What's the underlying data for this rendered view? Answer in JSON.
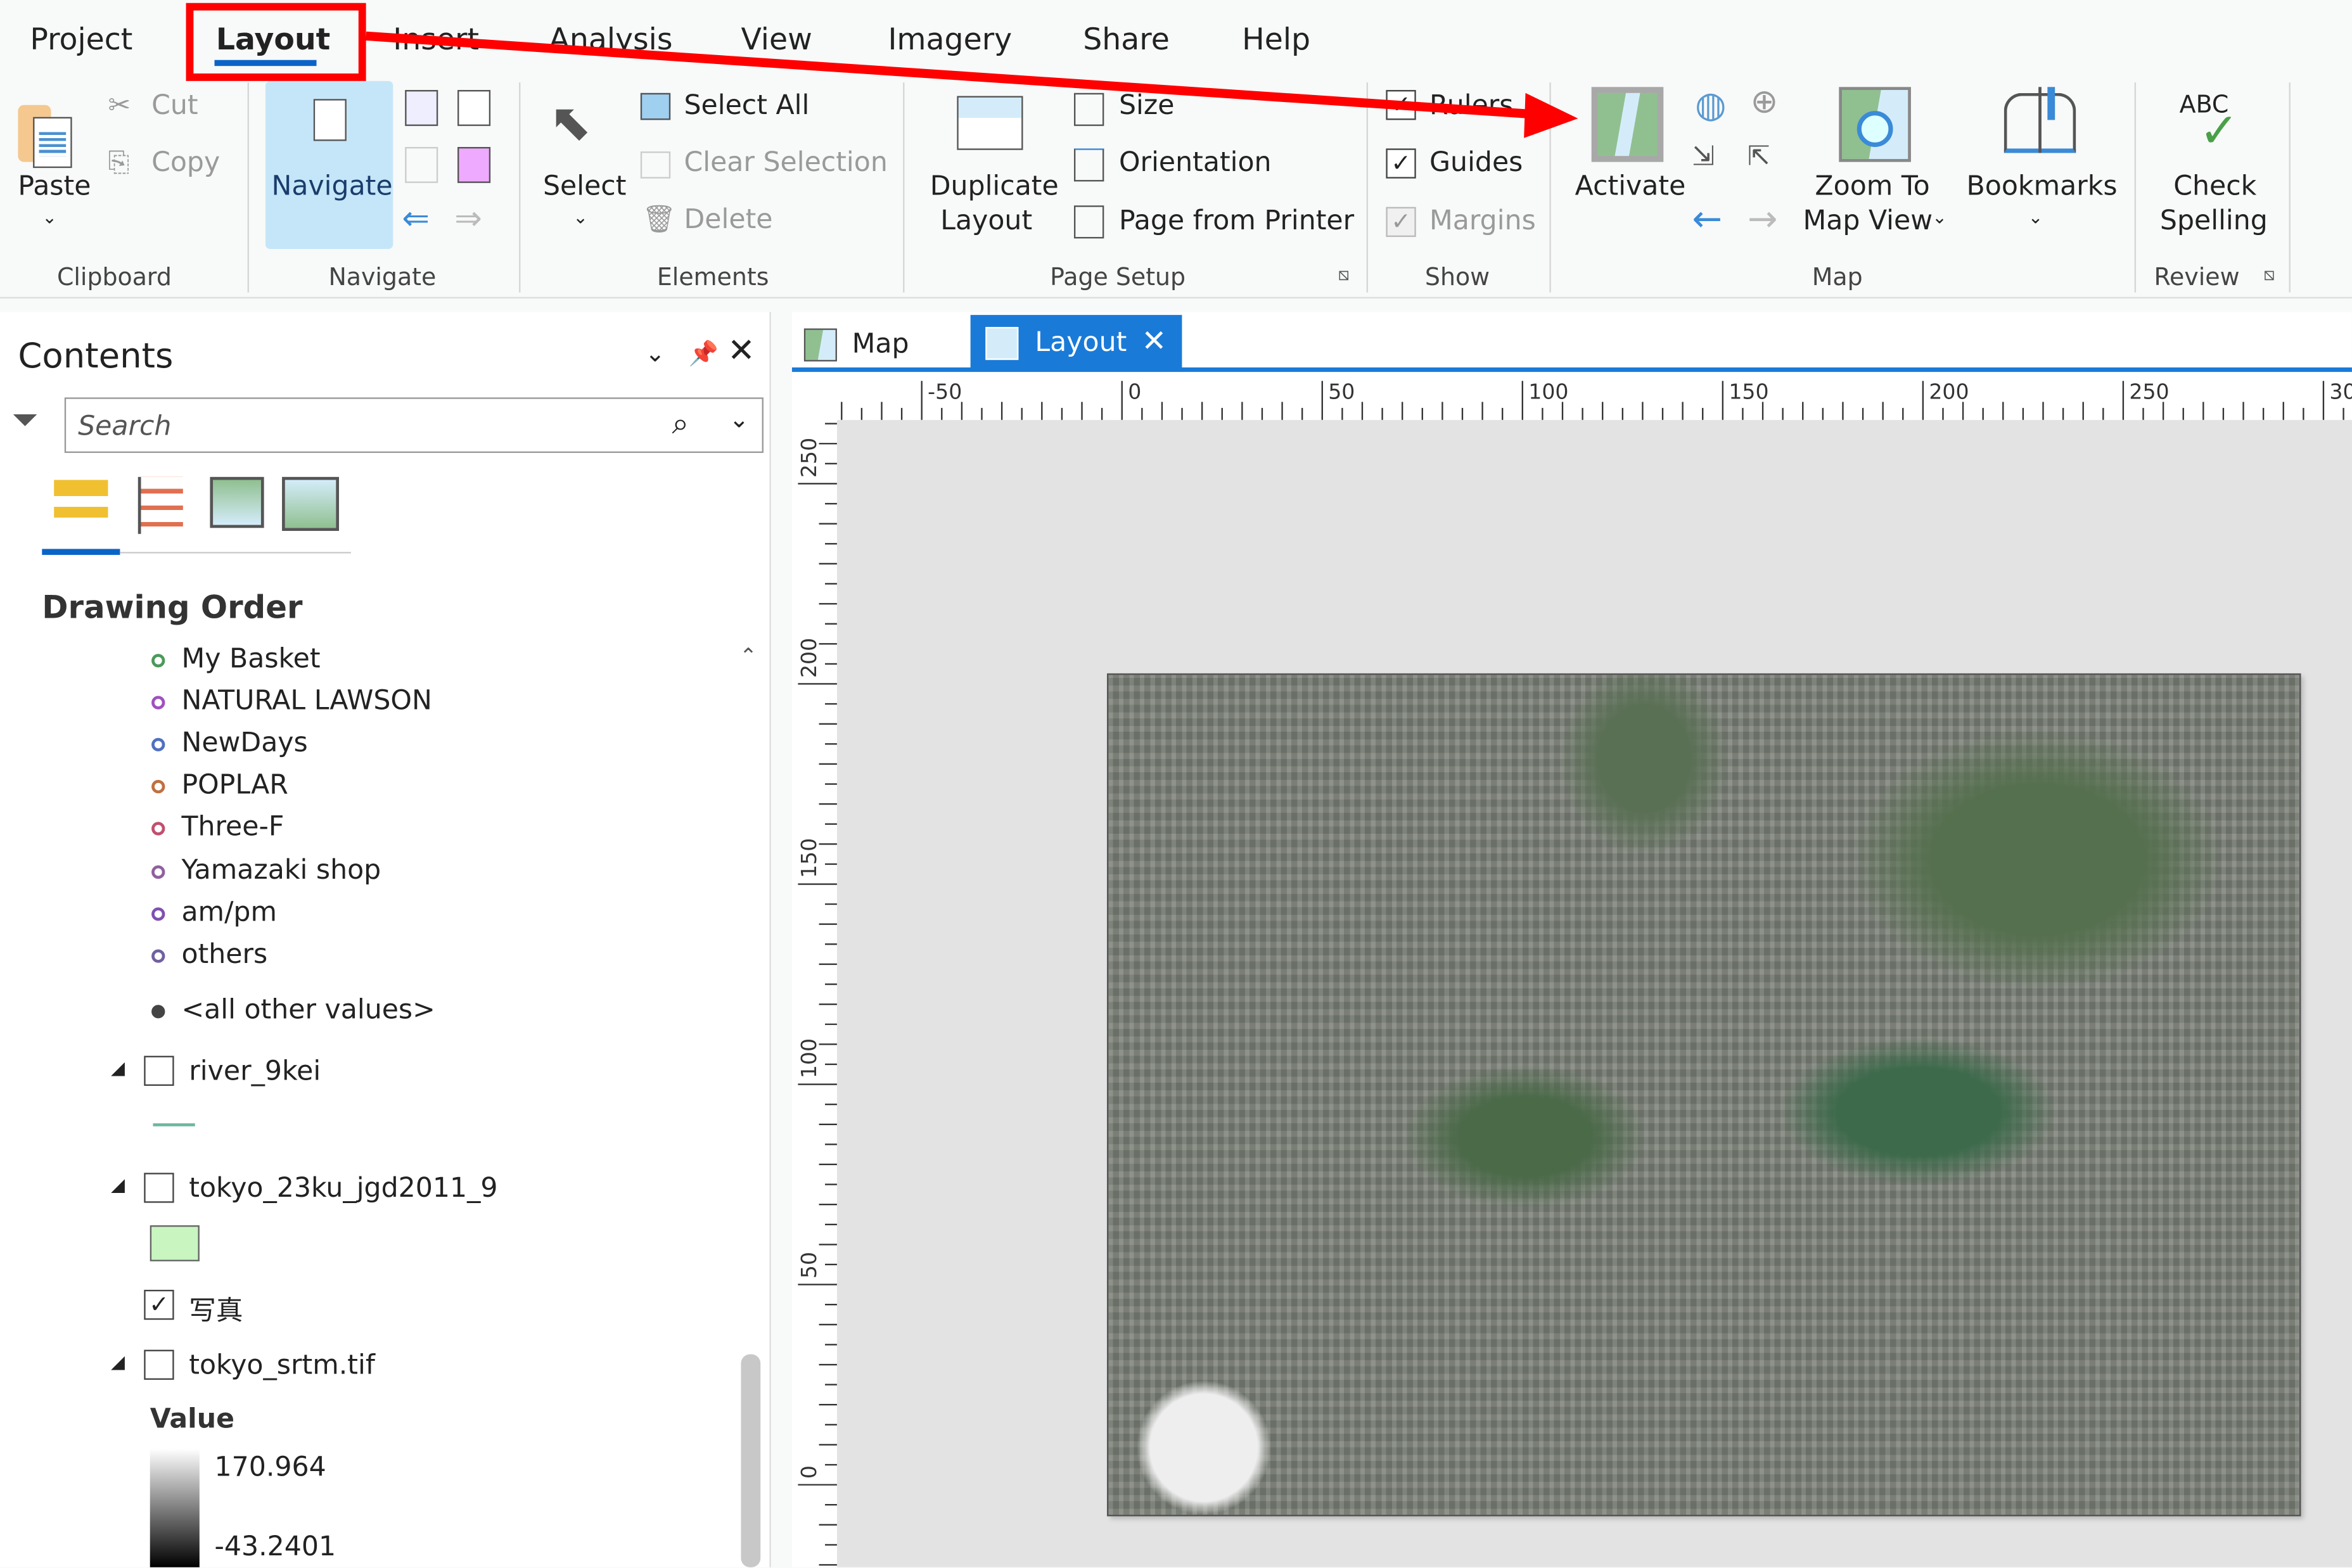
{
  "ribbon": {
    "tabs": [
      "Project",
      "Layout",
      "Insert",
      "Analysis",
      "View",
      "Imagery",
      "Share",
      "Help"
    ],
    "active_tab": "Layout",
    "clipboard": {
      "paste": "Paste",
      "cut": "Cut",
      "copy": "Copy",
      "label": "Clipboard"
    },
    "navigate": {
      "navigate": "Navigate",
      "label": "Navigate"
    },
    "elements": {
      "select": "Select",
      "select_all": "Select All",
      "clear_selection": "Clear Selection",
      "delete": "Delete",
      "label": "Elements"
    },
    "page_setup": {
      "duplicate_1": "Duplicate",
      "duplicate_2": "Layout",
      "size": "Size",
      "orientation": "Orientation",
      "page_from_printer": "Page from Printer",
      "label": "Page Setup"
    },
    "show": {
      "rulers": "Rulers",
      "guides": "Guides",
      "margins": "Margins",
      "label": "Show",
      "rulers_checked": true,
      "guides_checked": true,
      "margins_checked": true
    },
    "map": {
      "activate": "Activate",
      "zoom_to_1": "Zoom To",
      "zoom_to_2": "Map View",
      "bookmarks": "Bookmarks",
      "label": "Map"
    },
    "review": {
      "check_1": "Check",
      "check_2": "Spelling",
      "abc": "ABC",
      "label": "Review"
    }
  },
  "annotation": {
    "color": "#ff0000"
  },
  "contents": {
    "title": "Contents",
    "search_placeholder": "Search",
    "drawing_order": "Drawing Order",
    "symbols": [
      {
        "label": "My Basket",
        "color": "#4a9a5a"
      },
      {
        "label": "NATURAL LAWSON",
        "color": "#a050c0"
      },
      {
        "label": "NewDays",
        "color": "#5070c0"
      },
      {
        "label": "POPLAR",
        "color": "#c07040"
      },
      {
        "label": "Three-F",
        "color": "#c05070"
      },
      {
        "label": "Yamazaki shop",
        "color": "#9060a0"
      },
      {
        "label": "am/pm",
        "color": "#8050b0"
      },
      {
        "label": "others",
        "color": "#7060a0"
      },
      {
        "label": "<all other values>",
        "color": "#444444"
      }
    ],
    "layers": [
      {
        "name": "river_9kei",
        "checked": false
      },
      {
        "name": "tokyo_23ku_jgd2011_9",
        "checked": false
      },
      {
        "name": "写真",
        "checked": true
      },
      {
        "name": "tokyo_srtm.tif",
        "checked": false
      }
    ],
    "river_color": "#6cb8a0",
    "polygon_color": "#c8f5c0",
    "value_label": "Value",
    "value_max": "170.964",
    "value_min": "-43.2401"
  },
  "view_tabs": [
    {
      "label": "Map"
    },
    {
      "label": "Layout",
      "active": true
    }
  ],
  "ruler": {
    "h_labels": [
      "-50",
      "0",
      "50",
      "100",
      "150",
      "200",
      "250",
      "30"
    ],
    "v_labels": [
      "250",
      "200",
      "150",
      "100",
      "50",
      "0"
    ]
  }
}
